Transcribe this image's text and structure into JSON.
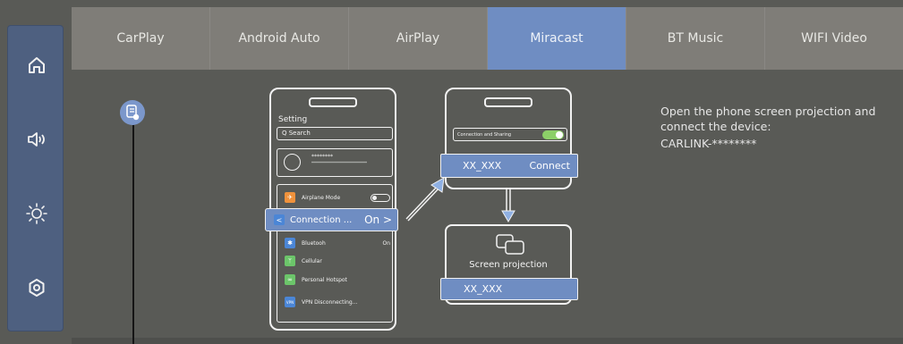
{
  "sidebar": {
    "items": [
      {
        "icon": "home-icon"
      },
      {
        "icon": "volume-icon"
      },
      {
        "icon": "brightness-icon"
      },
      {
        "icon": "settings-icon"
      }
    ]
  },
  "tabs": [
    {
      "label": "CarPlay",
      "active": false
    },
    {
      "label": "Android Auto",
      "active": false
    },
    {
      "label": "AirPlay",
      "active": false
    },
    {
      "label": "Miracast",
      "active": true
    },
    {
      "label": "BT Music",
      "active": false
    },
    {
      "label": "WIFI Video",
      "active": false
    }
  ],
  "phone": {
    "title": "Setting",
    "search_placeholder": "Q  Search",
    "profile_name": "********",
    "profile_sub": "*******************************",
    "rows": [
      {
        "label": "Airplane Mode",
        "icon": "airplane-icon",
        "color": "#f0923c",
        "value": ""
      },
      {
        "label": "Bluetooh",
        "icon": "bluetooth-icon",
        "color": "#4b86d6",
        "value": "On"
      },
      {
        "label": "Cellular",
        "icon": "cellular-icon",
        "color": "#6cc56a",
        "value": ""
      },
      {
        "label": "Personal Hotspot",
        "icon": "hotspot-icon",
        "color": "#6cc56a",
        "value": ""
      },
      {
        "label": "VPN Disconnecting...",
        "icon": "vpn-icon",
        "color": "#4b86d6",
        "value": ""
      }
    ],
    "connection_label": "Connection ...",
    "connection_value": "On  >"
  },
  "phone2": {
    "sharing_label": "Connection and Sharing",
    "device_name": "XX_XXX",
    "connect_label": "Connect"
  },
  "projection": {
    "label": "Screen projection",
    "device_name": "XX_XXX"
  },
  "instructions": {
    "text": "Open the phone screen projection and connect the device:",
    "device": "CARLINK-********"
  },
  "colors": {
    "accent": "#6f8dc2",
    "background": "#595a56",
    "tabbar": "#7f7d78",
    "sidebar": "#4e6080"
  }
}
